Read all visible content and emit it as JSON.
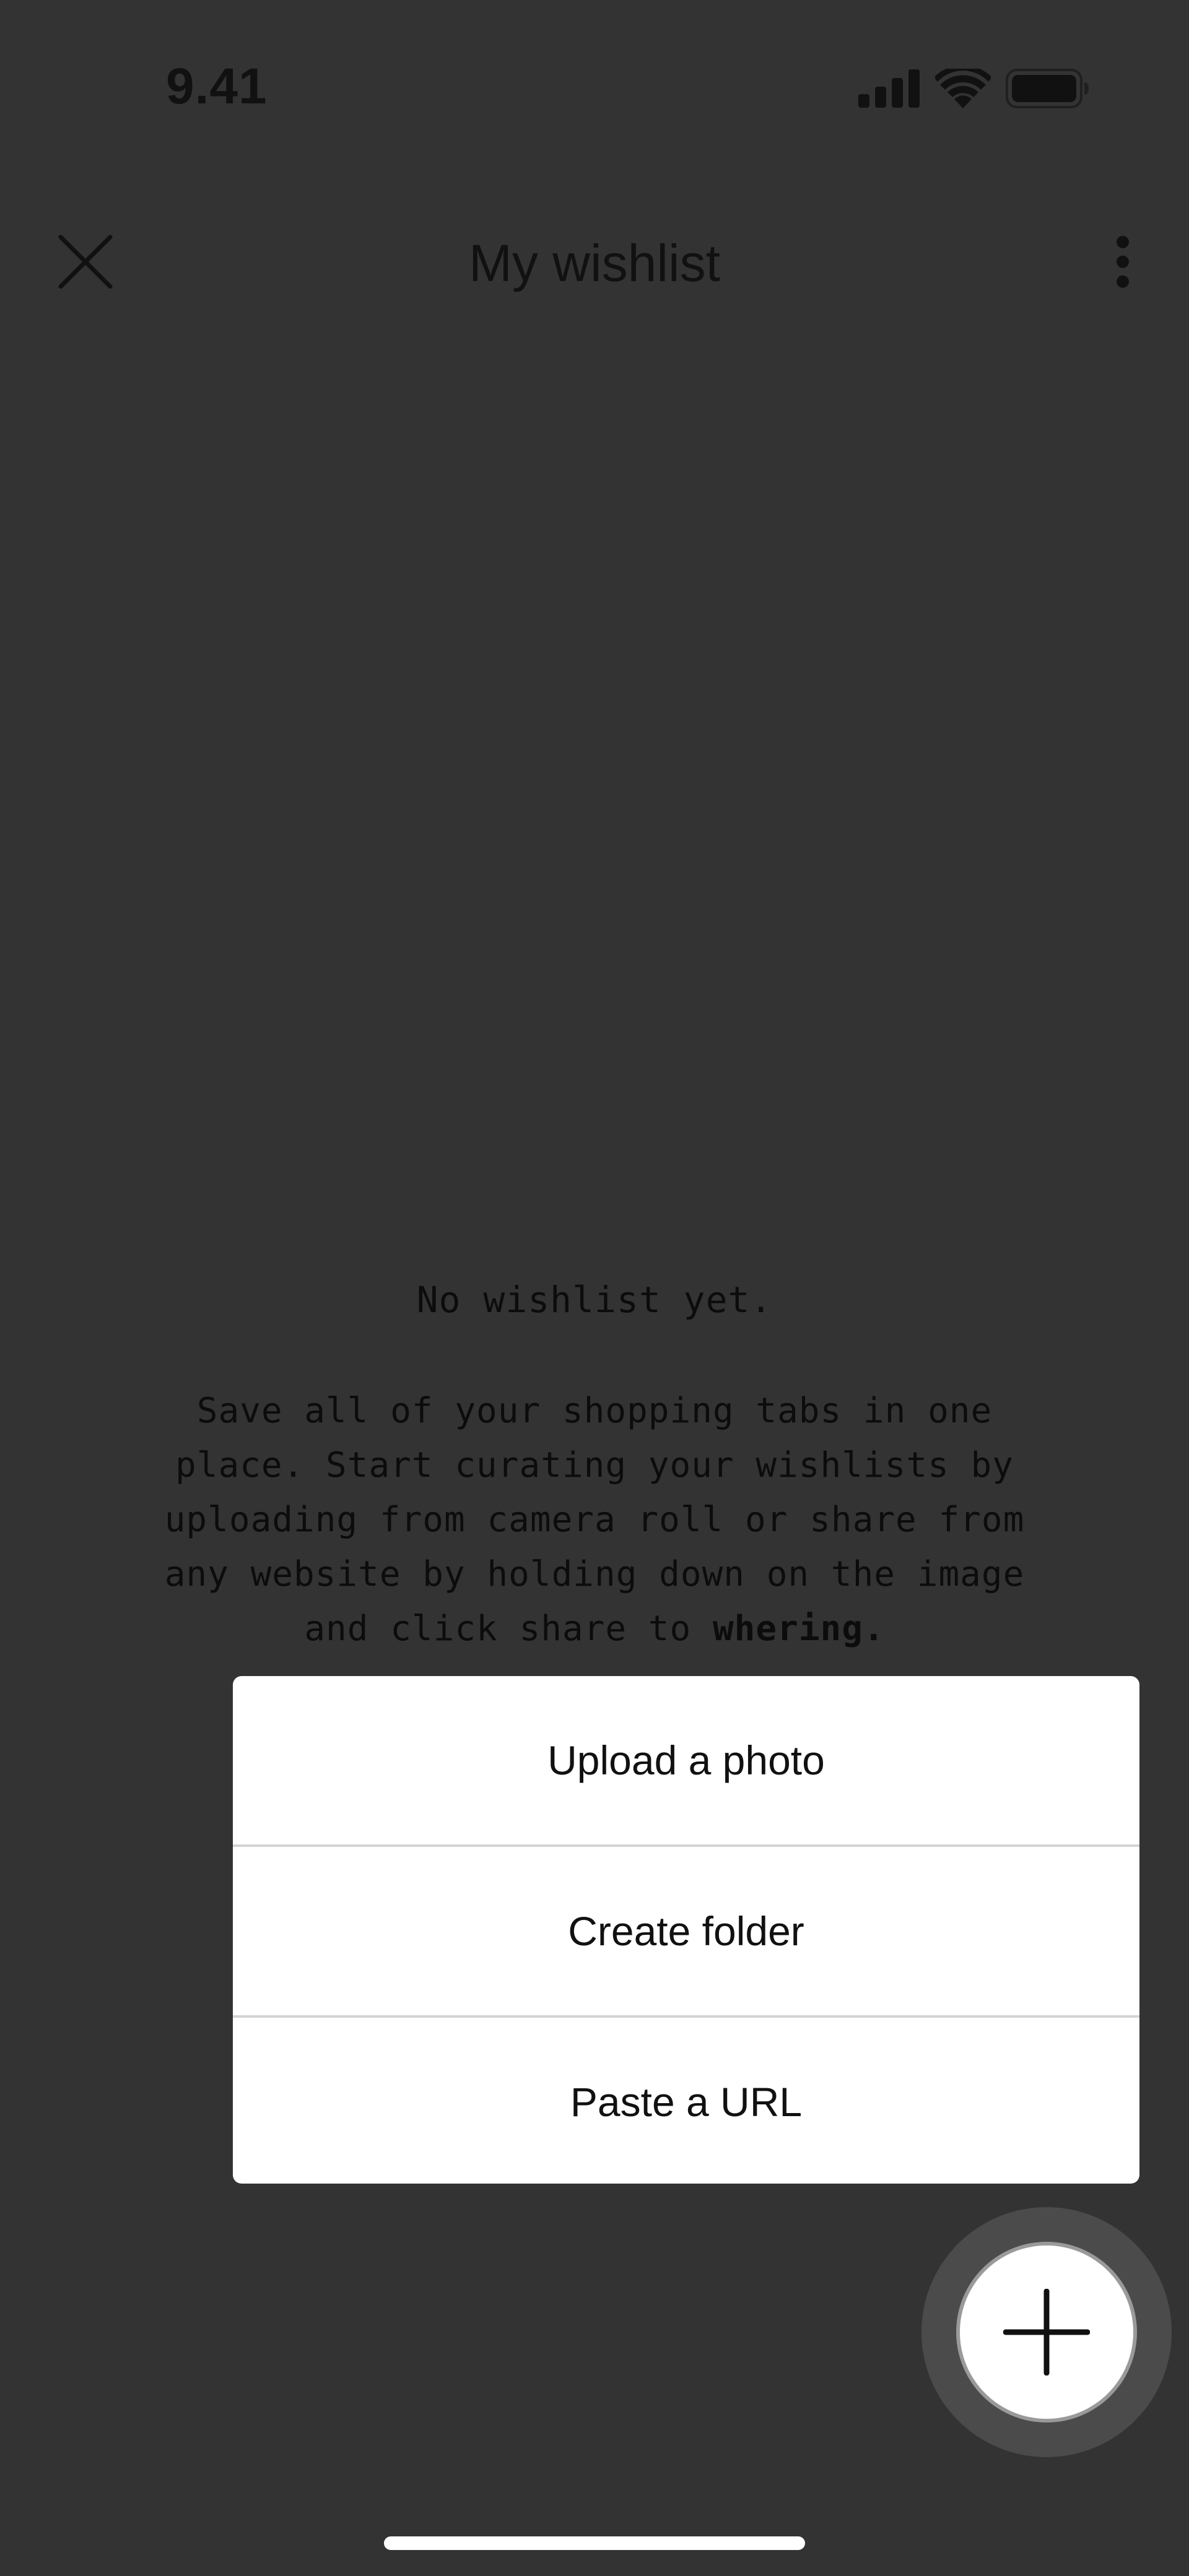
{
  "status_bar": {
    "time": "9.41",
    "icons": [
      "cellular-signal-icon",
      "wifi-icon",
      "battery-icon"
    ]
  },
  "header": {
    "title": "My wishlist",
    "close_icon": "close-icon",
    "more_icon": "more-vertical-icon"
  },
  "empty_state": {
    "heading": "No wishlist yet.",
    "body_prefix": "Save all of your shopping tabs in one place. Start curating your wishlists by uploading from camera roll or share from any website by holding down on the image and click share to ",
    "body_brand": "whering."
  },
  "action_menu": {
    "items": [
      {
        "label": "Upload a photo"
      },
      {
        "label": "Create folder"
      },
      {
        "label": "Paste a URL"
      }
    ]
  },
  "fab": {
    "icon": "plus-icon"
  },
  "colors": {
    "background": "#333333",
    "menu_background": "#ffffff",
    "fab_halo": "#4b4b4b",
    "text": "#111111"
  }
}
